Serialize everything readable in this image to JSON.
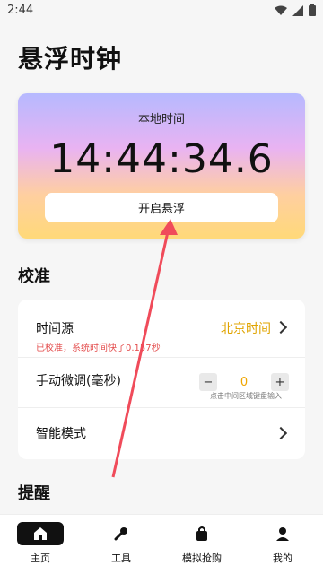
{
  "status": {
    "time": "2:44"
  },
  "page": {
    "title": "悬浮时钟"
  },
  "clock": {
    "label": "本地时间",
    "time": "14:44:34.6",
    "float_button": "开启悬浮"
  },
  "sections": {
    "calibrate_title": "校准",
    "reminder_title": "提醒"
  },
  "calibration": {
    "time_source_label": "时间源",
    "time_source_value": "北京时间",
    "time_source_note": "已校准，系统时间快了0.157秒",
    "manual_label": "手动微调(毫秒)",
    "manual_value": "0",
    "manual_hint": "点击中间区域键盘输入",
    "smart_label": "智能模式"
  },
  "tabs": [
    {
      "label": "主页",
      "icon": "home-icon"
    },
    {
      "label": "工具",
      "icon": "wrench-icon"
    },
    {
      "label": "模拟抢购",
      "icon": "bag-icon"
    },
    {
      "label": "我的",
      "icon": "user-icon"
    }
  ],
  "colors": {
    "accent": "#e0a400",
    "note_red": "#e34b4b",
    "arrow": "#f04b5a"
  }
}
